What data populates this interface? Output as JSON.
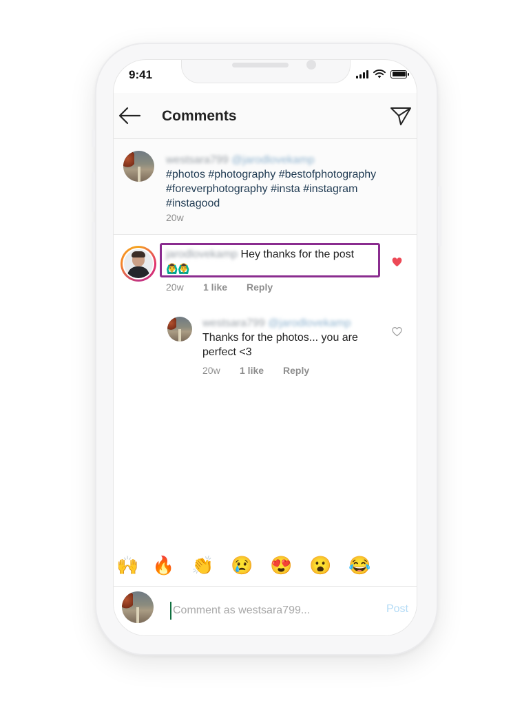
{
  "status_bar": {
    "time": "9:41"
  },
  "header": {
    "title": "Comments",
    "back_icon": "back-arrow-icon",
    "send_icon": "paper-plane-icon"
  },
  "caption": {
    "username": "westsara799",
    "mention": "@jarodlovekamp",
    "hashtags": "#photos #photography #bestofphotography #foreverphotography #insta #instagram #instagood",
    "time": "20w"
  },
  "comment": {
    "username": "jarodlovekamp",
    "text": "Hey thanks for the post",
    "emoji": "🙆‍♂️🙆‍♂️",
    "time": "20w",
    "likes": "1 like",
    "reply_label": "Reply",
    "liked": true
  },
  "reply": {
    "username": "westsara799",
    "mention": "@jarodlovekamp",
    "text": "Thanks for the photos... you are perfect <3",
    "time": "20w",
    "likes": "1 like",
    "reply_label": "Reply",
    "liked": false
  },
  "emoji_bar": [
    "🙌",
    "🔥",
    "👏",
    "😢",
    "😍",
    "😮",
    "😂"
  ],
  "composer": {
    "placeholder": "Comment as westsara799...",
    "post_label": "Post"
  },
  "colors": {
    "highlight": "#8a2c8f",
    "heart_liked": "#ed4956",
    "hashtag": "#1f3a52",
    "post_disabled": "#b3dbf6"
  }
}
